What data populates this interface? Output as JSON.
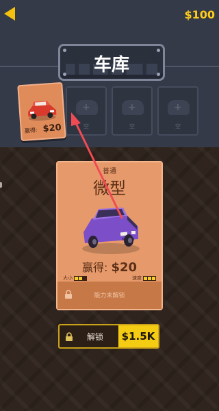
{
  "header": {
    "money": "$100"
  },
  "title": "车库",
  "owned_card": {
    "earn_label": "赢得:",
    "earn_value": "$20"
  },
  "slots": [
    {
      "label": "空"
    },
    {
      "label": "空"
    },
    {
      "label": "空"
    }
  ],
  "car_card": {
    "rarity": "普通",
    "name": "微型",
    "earn_label": "赢得:",
    "earn_value": "$20",
    "size_label": "大小",
    "size_level": 2,
    "speed_label": "速度",
    "speed_level": 3,
    "max_level": 3,
    "locked_text": "能力未解锁"
  },
  "unlock_button": {
    "label": "解锁",
    "price": "$1.5K"
  },
  "colors": {
    "accent": "#f5cc14",
    "card": "#e69a6b",
    "owned_car": "#d93a2b",
    "car": "#8a5bd6"
  }
}
